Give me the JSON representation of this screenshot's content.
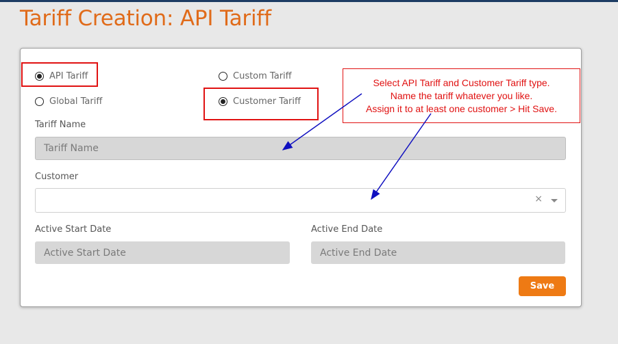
{
  "page": {
    "title": "Tariff Creation: API Tariff"
  },
  "tariff_types": {
    "api": {
      "label": "API Tariff",
      "selected": true
    },
    "custom": {
      "label": "Custom Tariff",
      "selected": false
    },
    "global": {
      "label": "Global Tariff",
      "selected": false
    },
    "customer": {
      "label": "Customer Tariff",
      "selected": true
    }
  },
  "tariff_name": {
    "label": "Tariff Name",
    "placeholder": "Tariff Name"
  },
  "customer": {
    "label": "Customer",
    "clear_glyph": "×"
  },
  "active_start_date": {
    "label": "Active Start Date",
    "placeholder": "Active Start Date"
  },
  "active_end_date": {
    "label": "Active End Date",
    "placeholder": "Active End Date"
  },
  "actions": {
    "save_label": "Save"
  },
  "annotation": {
    "lines": [
      "Select API Tariff and Customer Tariff type.",
      "Name the tariff whatever you like.",
      "Assign it to at least one customer > Hit Save."
    ]
  },
  "colors": {
    "title": "#e06b1a",
    "accent": "#ee7a14",
    "annotation": "#e01010",
    "arrow": "#1010c0",
    "topbar": "#1d3c63"
  }
}
